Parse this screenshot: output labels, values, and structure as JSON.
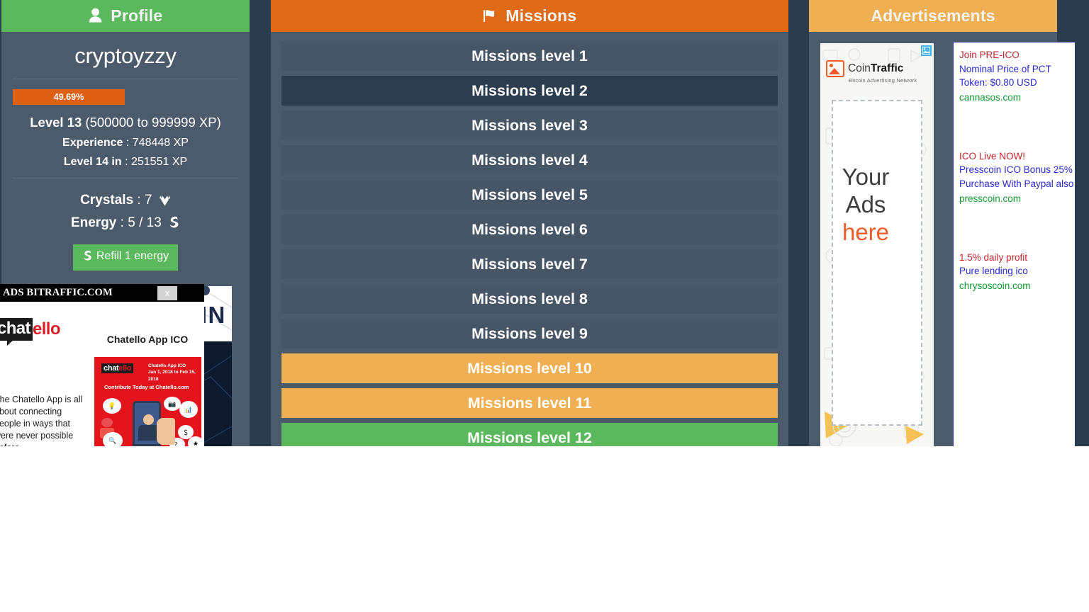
{
  "theme": {
    "page_bg": "#2b3c4e",
    "panel_bg": "#4c5b6b",
    "profile_header": "#5cb85c",
    "missions_header": "#e06a16",
    "ads_header": "#efaf52",
    "progress_fill": "#dd6013",
    "row_default": "#475667",
    "row_active": "#2b3d4f",
    "row_warning": "#efaf52",
    "row_success": "#5cb85c"
  },
  "profile": {
    "header": "Profile",
    "header_icon": "user-icon",
    "username": "cryptoyzzy",
    "progress": {
      "percent_label": "49.69%",
      "percent": 49.69
    },
    "level_label": "Level 13",
    "level_range": "(500000 to 999999 XP)",
    "stats": [
      {
        "label": "Experience",
        "sep": " : ",
        "value": "748448 XP"
      },
      {
        "label": "Level 14 in",
        "sep": " : ",
        "value": "251551 XP"
      }
    ],
    "crystals_label": "Crystals",
    "crystals_value": "7",
    "crystals_icon": "gem-icon",
    "energy_label": "Energy",
    "energy_value": "5 / 13",
    "energy_icon": "bolt-spiral-icon",
    "refill_button": "Refill 1 energy",
    "refill_icon": "bolt-spiral-icon",
    "banner": {
      "brand": "PRESSCOIN",
      "logo_icon": "presscoin-logo-icon"
    }
  },
  "missions": {
    "header": "Missions",
    "header_icon": "flag-icon",
    "rows": [
      {
        "label": "Missions level 1",
        "state": "default"
      },
      {
        "label": "Missions level 2",
        "state": "active"
      },
      {
        "label": "Missions level 3",
        "state": "default"
      },
      {
        "label": "Missions level 4",
        "state": "default"
      },
      {
        "label": "Missions level 5",
        "state": "default"
      },
      {
        "label": "Missions level 6",
        "state": "default"
      },
      {
        "label": "Missions level 7",
        "state": "default"
      },
      {
        "label": "Missions level 8",
        "state": "default"
      },
      {
        "label": "Missions level 9",
        "state": "default"
      },
      {
        "label": "Missions level 10",
        "state": "warning"
      },
      {
        "label": "Missions level 11",
        "state": "warning"
      },
      {
        "label": "Missions level 12",
        "state": "success"
      }
    ]
  },
  "ads": {
    "header": "Advertisements",
    "banner": {
      "brand_light": "Coin",
      "brand_bold": "Traffic",
      "tagline": "Bitcoin Advertising Network",
      "placeholder_line1": "Your",
      "placeholder_line2": "Ads",
      "placeholder_line3": "here",
      "broken_image_icon": "broken-image-icon",
      "image_icon": "image-placeholder-icon"
    },
    "text_ads": [
      {
        "title": "Join PRE-ICO",
        "body": "Nominal Price of PCT Token: $0.80 USD",
        "url": "cannasos.com"
      },
      {
        "title": "ICO Live NOW!",
        "body": "Presscoin ICO Bonus 25% Purchase With Paypal also",
        "url": "presscoin.com"
      },
      {
        "title": "1.5% daily profit",
        "body": "Pure lending ico",
        "url": "chrysoscoin.com"
      }
    ]
  },
  "popup": {
    "title": "ADS BITRAFFIC.COM",
    "close_label": "x",
    "close_icon": "close-icon",
    "logo_dark": "chat",
    "logo_red": "ello",
    "heading": "Chatello App ICO",
    "description": "The Chatello App is all about connecting people in ways that were never possible before",
    "card": {
      "logo_dark": "chat",
      "logo_red": "ello",
      "dates": "Chatello App ICO\nJan 1, 2018 to Feb 15, 2018",
      "cta": "Contribute Today at Chatello.com"
    }
  }
}
